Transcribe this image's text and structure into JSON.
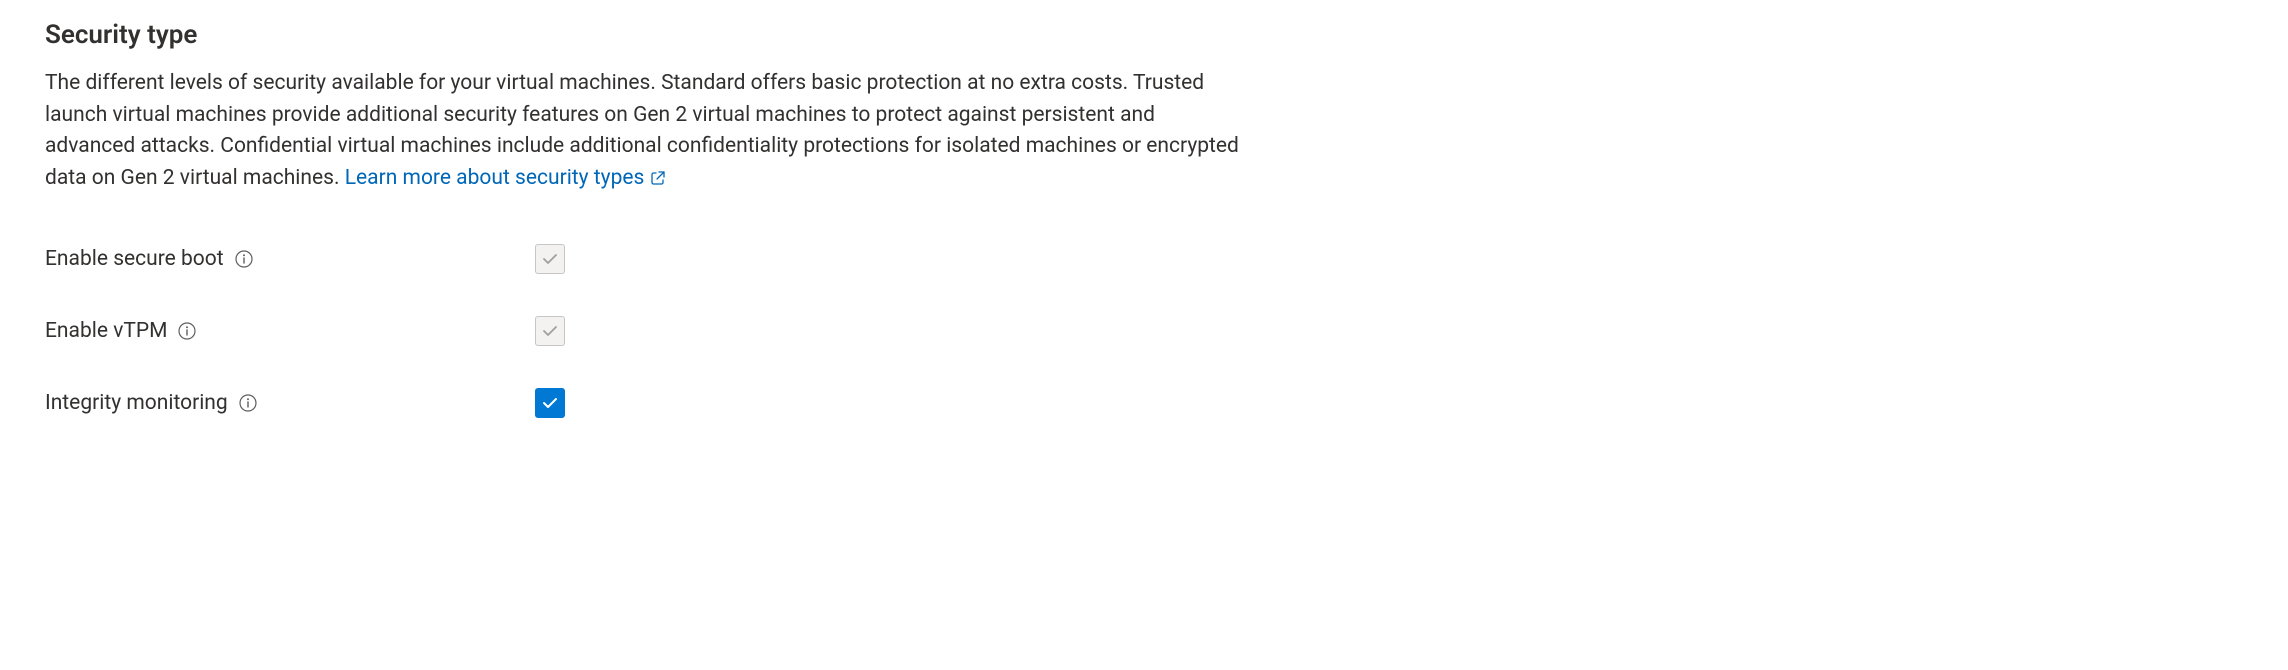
{
  "section": {
    "heading": "Security type",
    "description": "The different levels of security available for your virtual machines. Standard offers basic protection at no extra costs. Trusted launch virtual machines provide additional security features on Gen 2 virtual machines to protect against persistent and advanced attacks. Confidential virtual machines include additional confidentiality protections for isolated machines or encrypted data on Gen 2 virtual machines.",
    "learnMoreLabel": "Learn more about security types"
  },
  "fields": {
    "secureBoot": {
      "label": "Enable secure boot",
      "checked": true,
      "disabled": true
    },
    "vtpm": {
      "label": "Enable vTPM",
      "checked": true,
      "disabled": true
    },
    "integrityMonitoring": {
      "label": "Integrity monitoring",
      "checked": true,
      "disabled": false
    }
  },
  "colors": {
    "linkColor": "#0067b8",
    "primaryBlue": "#0078d4",
    "textColor": "#323130",
    "disabledBg": "#f3f2f1",
    "disabledBorder": "#c8c6c4",
    "disabledCheck": "#a19f9d"
  }
}
